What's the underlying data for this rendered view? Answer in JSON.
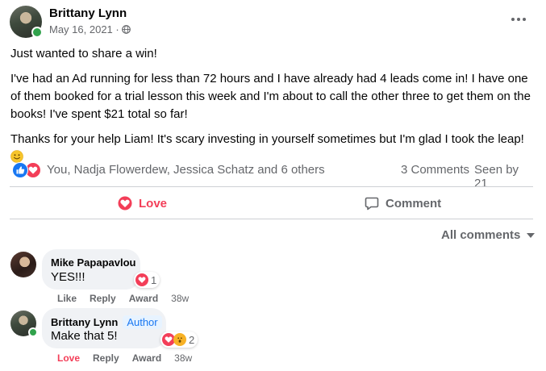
{
  "post": {
    "author": "Brittany Lynn",
    "date": "May 16, 2021 ·",
    "paragraphs": [
      "Just wanted to share a win!",
      "I've had an Ad running for less than 72 hours and I have already had 4 leads come in! I have one of them booked for a trial lesson this week and I'm about to call the other three to get them on the books! I've spent $21 total so far!",
      "Thanks for your help Liam! It's scary investing in yourself sometimes but I'm glad I took the leap!"
    ],
    "emoji": "slightly-smiling-face-icon"
  },
  "summary": {
    "reactors": "You, Nadja Flowerdew, Jessica Schatz and 6 others",
    "comments": "3 Comments",
    "seen_by": "Seen by 21",
    "reaction_icons": [
      "like-icon",
      "love-icon"
    ]
  },
  "actions": {
    "love": "Love",
    "comment": "Comment"
  },
  "filter": {
    "label": "All comments"
  },
  "comments": [
    {
      "name": "Mike Papapavlou",
      "text": "YES!!!",
      "reaction_count": "1",
      "like": "Like",
      "reply": "Reply",
      "award": "Award",
      "age": "38w"
    },
    {
      "name": "Brittany Lynn",
      "badge": "Author",
      "text": "Make that 5!",
      "reaction_count": "2",
      "like": "Love",
      "reply": "Reply",
      "award": "Award",
      "age": "38w"
    }
  ],
  "colors": {
    "love": "#f33e58",
    "like": "#1877f2",
    "secondary_text": "#65676b",
    "bubble": "#f0f2f5",
    "online": "#31a24c"
  }
}
